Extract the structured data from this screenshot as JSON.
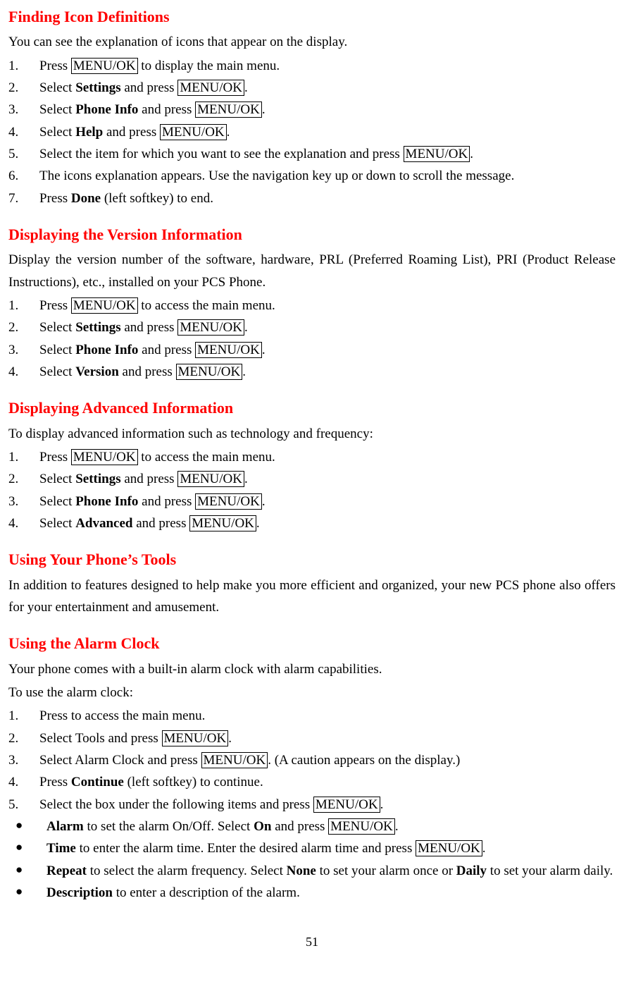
{
  "pageNumber": "51",
  "menuok": "MENU/OK",
  "sec1": {
    "heading": "Finding Icon Definitions",
    "intro": "You can see the explanation of icons that appear on the display.",
    "s1a": "Press ",
    "s1b": " to display the main menu.",
    "s2a": "Select ",
    "s2b": "Settings",
    "s2c": " and press ",
    "s2d": ".",
    "s3a": "Select ",
    "s3b": "Phone Info",
    "s3c": " and press ",
    "s3d": ".",
    "s4a": "Select ",
    "s4b": "Help",
    "s4c": " and press ",
    "s4d": ".",
    "s5a": "Select the item for which you want to see the explanation and press ",
    "s5b": ".",
    "s6": "The icons explanation appears. Use the navigation key up or down to scroll the message.",
    "s7a": "Press ",
    "s7b": "Done",
    "s7c": " (left softkey) to end."
  },
  "sec2": {
    "heading": "Displaying the Version Information",
    "intro": "Display the version number of the software, hardware, PRL (Preferred Roaming List), PRI (Product Release Instructions), etc., installed on your PCS Phone.",
    "s1a": "Press ",
    "s1b": " to access the main menu.",
    "s2a": "Select ",
    "s2b": "Settings",
    "s2c": " and press ",
    "s2d": ".",
    "s3a": "Select ",
    "s3b": "Phone Info",
    "s3c": " and press ",
    "s3d": ".",
    "s4a": "Select ",
    "s4b": "Version",
    "s4c": " and press ",
    "s4d": "."
  },
  "sec3": {
    "heading": "Displaying Advanced Information",
    "intro": "To display advanced information such as technology and frequency:",
    "s1a": "Press ",
    "s1b": " to access the main menu.",
    "s2a": "Select ",
    "s2b": "Settings",
    "s2c": " and press ",
    "s2d": ".",
    "s3a": "Select ",
    "s3b": "Phone Info",
    "s3c": " and press ",
    "s3d": ".",
    "s4a": "Select ",
    "s4b": "Advanced",
    "s4c": " and press ",
    "s4d": "."
  },
  "sec4": {
    "heading": "Using Your Phone’s Tools",
    "intro": "In addition to features designed to help make you more efficient and organized, your new PCS phone also offers for your entertainment and amusement."
  },
  "sec5": {
    "heading": "Using the Alarm Clock",
    "intro1": "Your phone comes with a built-in alarm clock with alarm capabilities.",
    "intro2": "To use the alarm clock:",
    "s1": "Press to access the main menu.",
    "s2a": "Select Tools and press ",
    "s2b": ".",
    "s3a": "Select Alarm Clock and press ",
    "s3b": ". (A caution appears on the display.)",
    "s4a": "Press ",
    "s4b": "Continue",
    "s4c": " (left softkey) to continue.",
    "s5a": "Select the box under the following items and press ",
    "s5b": ".",
    "b1a": "Alarm",
    "b1b": " to set the alarm On/Off. Select ",
    "b1c": "On",
    "b1d": " and press ",
    "b1e": ".",
    "b2a": "Time",
    "b2b": " to enter the alarm time. Enter the desired alarm time and press ",
    "b2c": ".",
    "b3a": "Repeat",
    "b3b": " to select the alarm frequency. Select ",
    "b3c": "None",
    "b3d": " to set your alarm once or ",
    "b3e": "Daily",
    "b3f": " to set your alarm daily.",
    "b4a": "Description",
    "b4b": " to enter a description of the alarm."
  }
}
